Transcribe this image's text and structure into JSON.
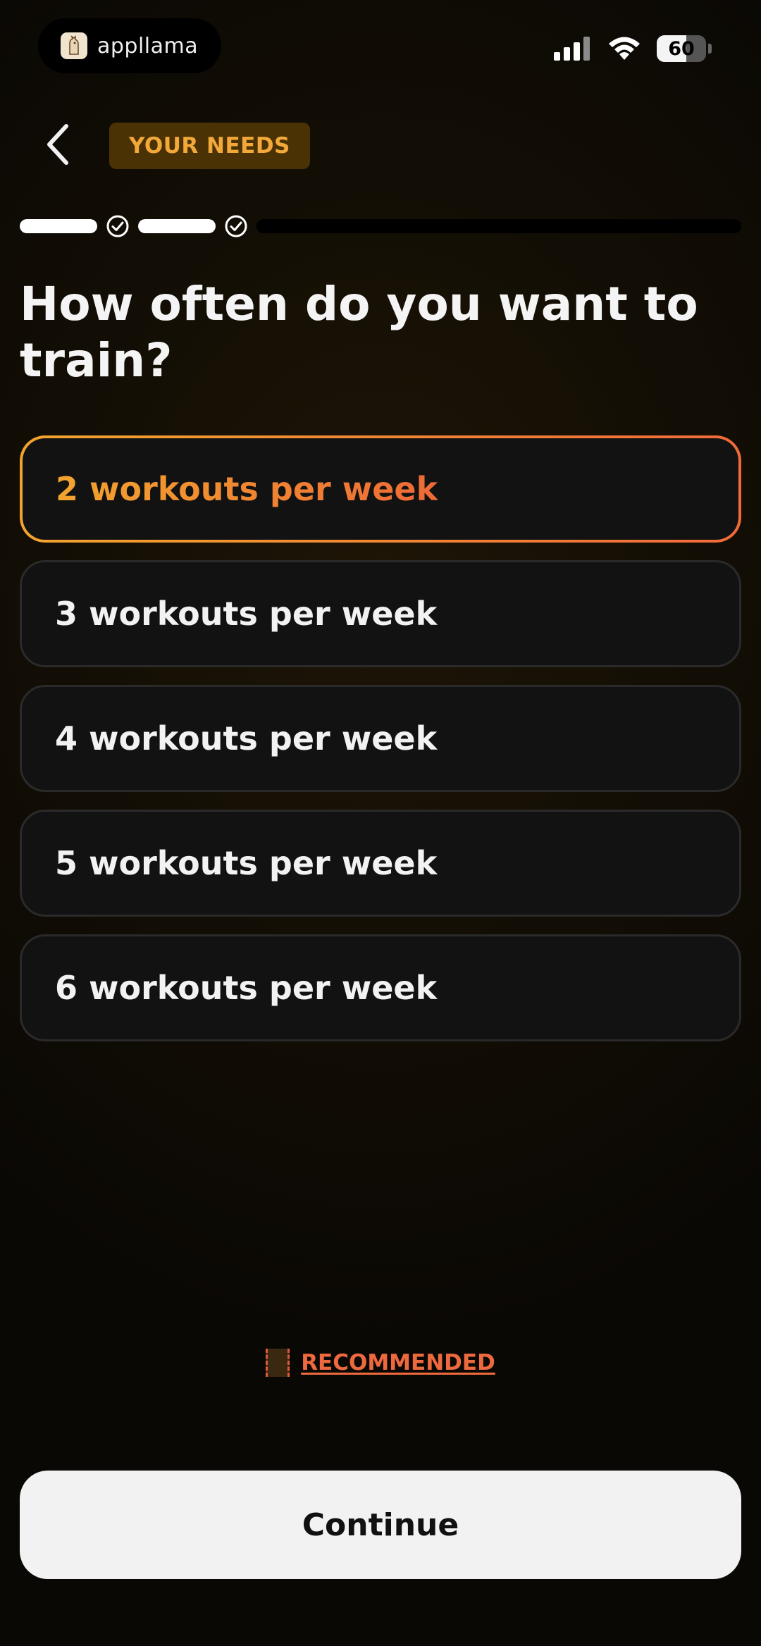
{
  "status_bar": {
    "app_brand": "appllama",
    "battery_level": "60",
    "battery_fraction": 0.6,
    "signal_icon": "cellular-signal-icon",
    "wifi_icon": "wifi-icon"
  },
  "header": {
    "back_icon": "chevron-left-icon",
    "section_label": "YOUR NEEDS"
  },
  "progress": {
    "completed_steps": 2,
    "check_icon": "check-circle-icon"
  },
  "question": {
    "title": "How often do you want to train?"
  },
  "options": [
    {
      "label": "2 workouts per week",
      "selected": true
    },
    {
      "label": "3 workouts per week",
      "selected": false
    },
    {
      "label": "4 workouts per week",
      "selected": false
    },
    {
      "label": "5 workouts per week",
      "selected": false
    },
    {
      "label": "6 workouts per week",
      "selected": false
    }
  ],
  "recommended": {
    "label": "RECOMMENDED"
  },
  "footer": {
    "continue_label": "Continue"
  },
  "colors": {
    "accent_start": "#f2a42e",
    "accent_end": "#f06a3a",
    "badge_bg": "#4a3204",
    "badge_text": "#f2a93a"
  }
}
